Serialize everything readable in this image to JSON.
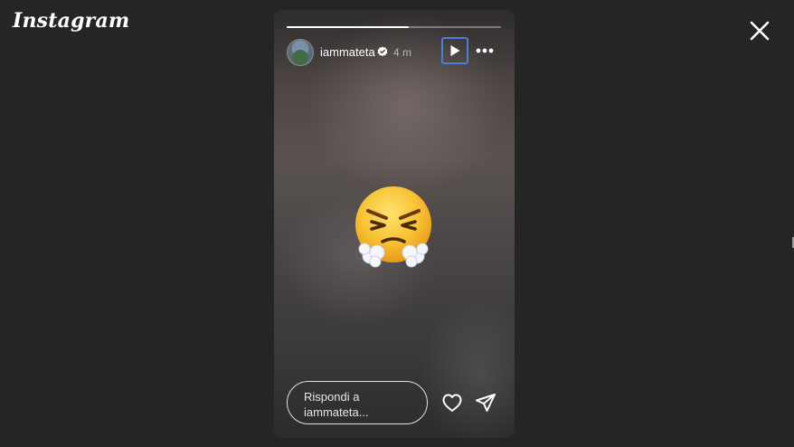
{
  "app": {
    "logo_text": "Instagram"
  },
  "story": {
    "progress": 0.57,
    "username": "iammateta",
    "verified": true,
    "timestamp": "4 m",
    "content_emoji": "face-with-steam-from-nose",
    "reply_placeholder": "Rispondi a iammateta..."
  },
  "icons": {
    "close": "close-icon",
    "play": "play-icon",
    "more": "more-options-icon",
    "verified": "verified-badge-icon",
    "like": "heart-icon",
    "share": "paper-plane-icon"
  },
  "colors": {
    "background": "#252525",
    "text": "#ffffff",
    "muted_text": "#b8b8b8",
    "focus_outline": "#4a7fd8",
    "verified_badge": "#ffffff"
  }
}
